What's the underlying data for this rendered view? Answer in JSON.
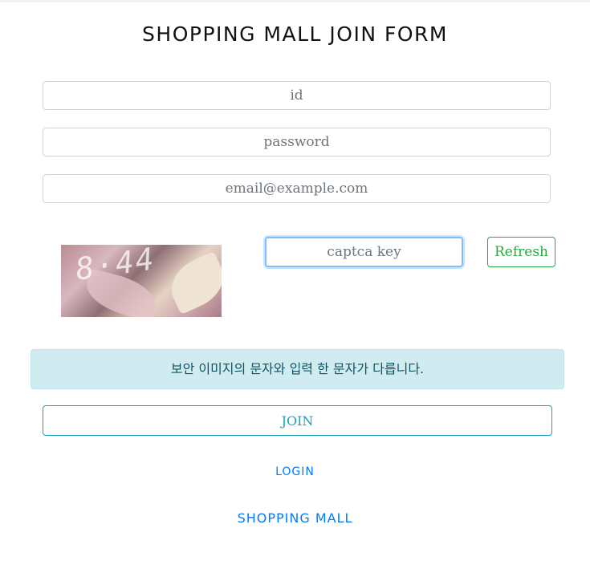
{
  "form": {
    "title": "SHOPPING MALL JOIN FORM",
    "id_placeholder": "id",
    "password_placeholder": "password",
    "email_placeholder": "email@example.com",
    "captcha_placeholder": "captca key",
    "captcha_image_text": "8·44",
    "refresh_label": "Refresh",
    "alert_message": "보안 이미지의 문자와 입력 한 문자가 다릅니다.",
    "join_label": "JOIN",
    "login_link": "LOGIN",
    "mall_link": "SHOPPING MALL"
  },
  "colors": {
    "refresh": "#28a745",
    "join": "#17a2b8",
    "alert_bg": "#d1ecf1",
    "link": "#007bff"
  }
}
